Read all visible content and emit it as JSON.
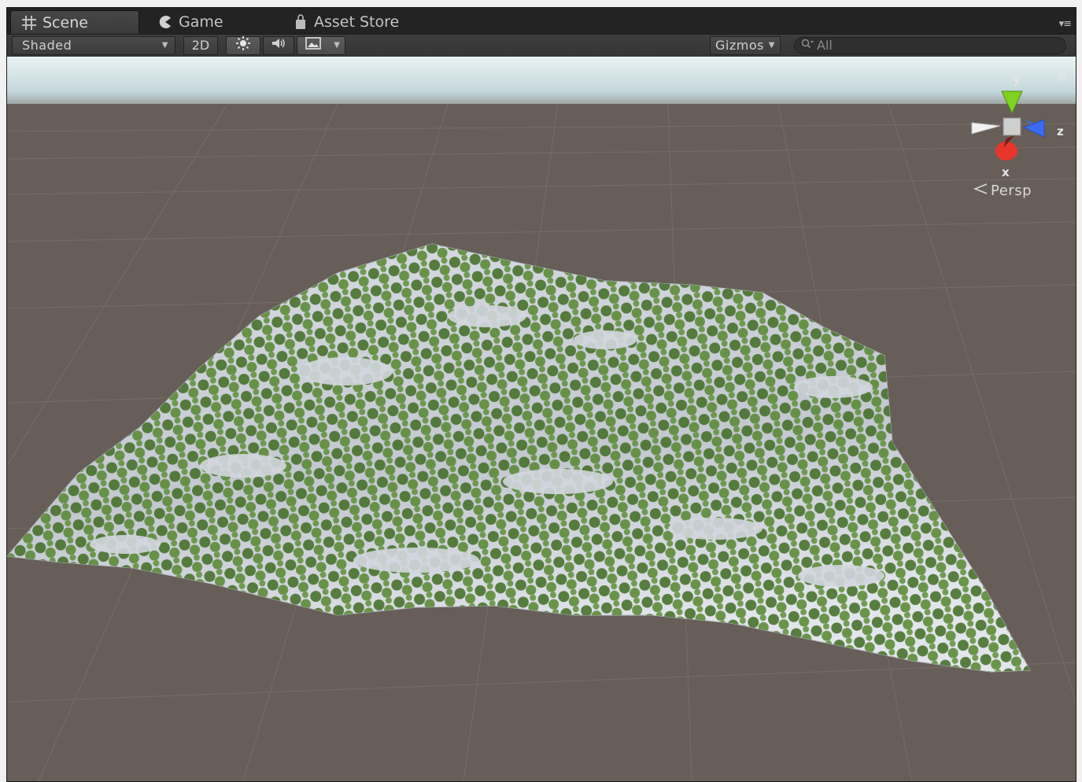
{
  "tabs": [
    {
      "label": "Scene",
      "icon": "grid-icon",
      "active": true
    },
    {
      "label": "Game",
      "icon": "pacman-icon",
      "active": false
    },
    {
      "label": "Asset Store",
      "icon": "bag-icon",
      "active": false
    }
  ],
  "toolbar": {
    "draw_mode": "Shaded",
    "mode_2d": "2D",
    "lighting_icon": "sun-icon",
    "audio_icon": "speaker-icon",
    "effects_icon": "image-icon",
    "gizmos_label": "Gizmos",
    "search_placeholder": "All"
  },
  "scene_gizmo": {
    "y_label": "y",
    "z_label": "z",
    "x_label": "x",
    "projection": "Persp",
    "colors": {
      "y": "#7ed321",
      "z": "#3b6cf0",
      "x": "#e8362b"
    }
  },
  "viewport": {
    "sky_color": "#dbe9ec",
    "ground_color": "#675e59",
    "terrain_snow": "#c9cdd6",
    "tree_color": "#4c7a2a"
  }
}
